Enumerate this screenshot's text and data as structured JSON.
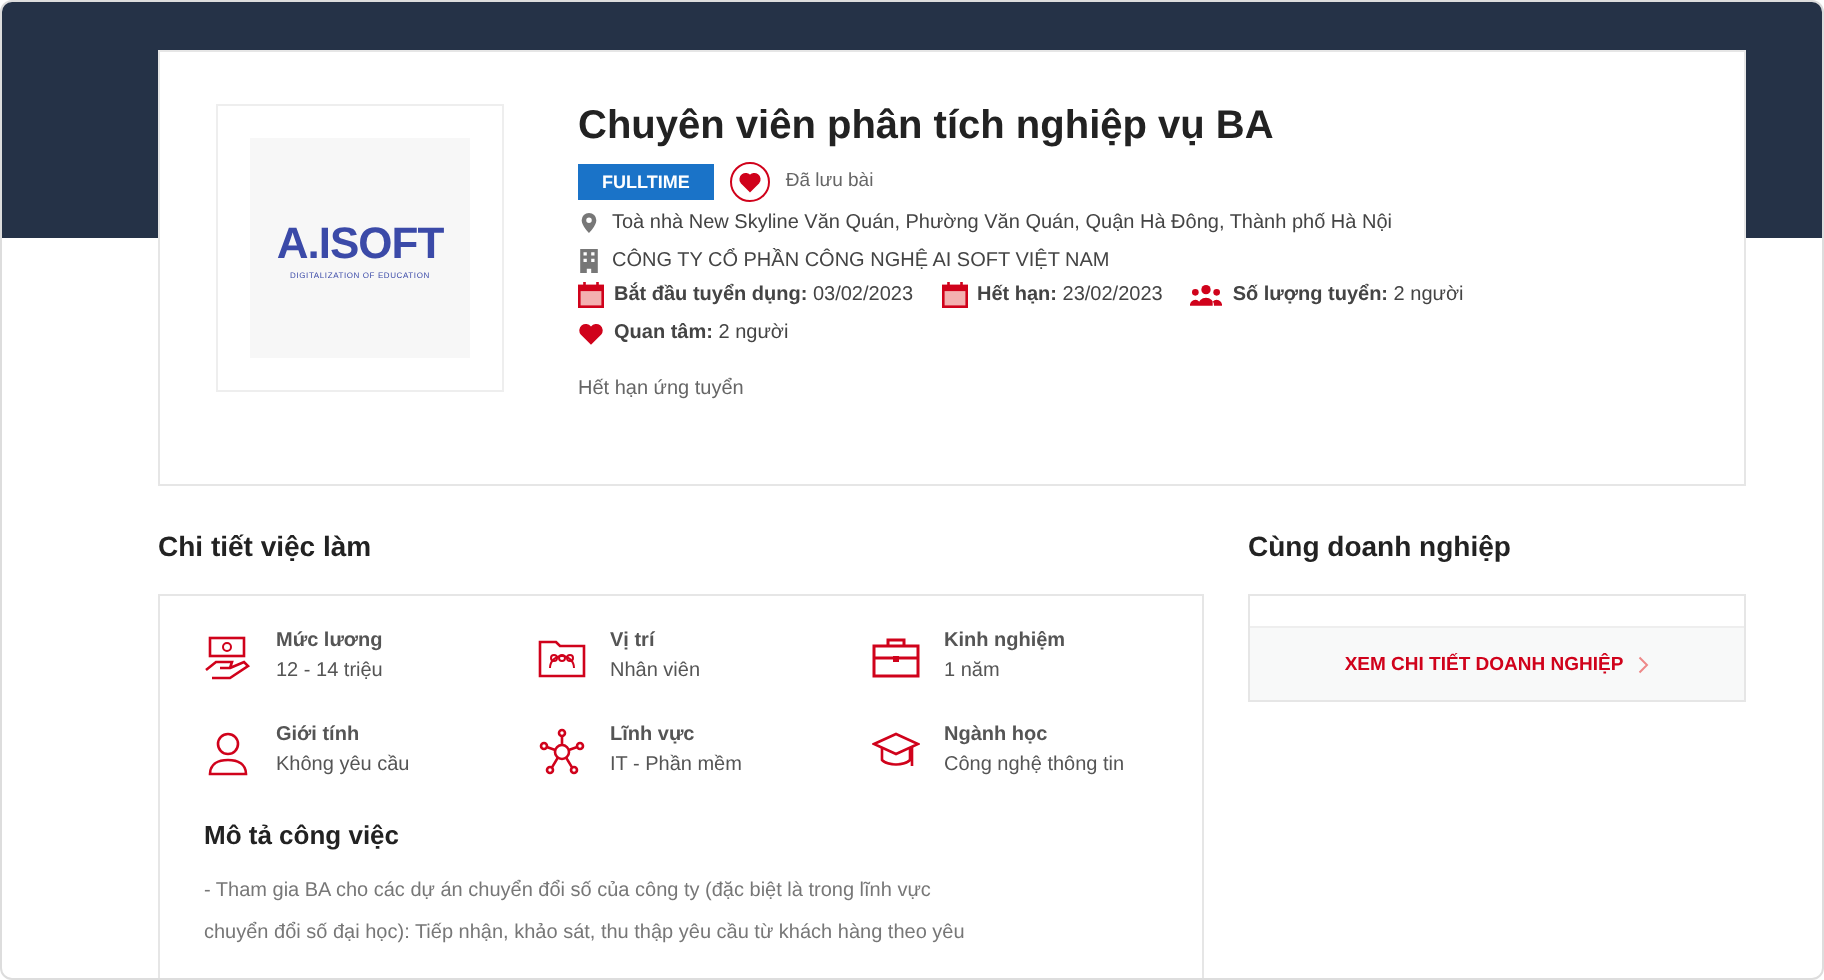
{
  "job": {
    "title": "Chuyên viên phân tích nghiệp vụ BA",
    "type_badge": "FULLTIME",
    "saved": true,
    "saved_label": "Đã lưu bài",
    "logo": {
      "name": "A.ISOFT",
      "tagline": "DIGITALIZATION OF EDUCATION"
    },
    "address": "Toà nhà New Skyline Văn Quán, Phường Văn Quán, Quận Hà Đông, Thành phố Hà Nội",
    "company": "CÔNG TY CỔ PHẦN CÔNG NGHỆ AI SOFT VIỆT NAM",
    "facts": [
      {
        "kind": "calendar",
        "label": "Bắt đầu tuyển dụng:",
        "value": "03/02/2023"
      },
      {
        "kind": "calendar",
        "label": "Hết hạn:",
        "value": "23/02/2023"
      },
      {
        "kind": "people",
        "label": "Số lượng tuyển:",
        "value": "2 người"
      },
      {
        "kind": "heart",
        "label": "Quan tâm:",
        "value": "2 người"
      }
    ],
    "status": "Hết hạn ứng tuyển"
  },
  "details": {
    "heading": "Chi tiết việc làm",
    "items": [
      {
        "kind": "salary",
        "label": "Mức lương",
        "value": "12 - 14 triệu"
      },
      {
        "kind": "position",
        "label": "Vị trí",
        "value": "Nhân viên"
      },
      {
        "kind": "experience",
        "label": "Kinh nghiệm",
        "value": "1 năm"
      },
      {
        "kind": "gender",
        "label": "Giới tính",
        "value": "Không yêu cầu"
      },
      {
        "kind": "field",
        "label": "Lĩnh vực",
        "value": "IT - Phần mềm"
      },
      {
        "kind": "major",
        "label": "Ngành học",
        "value": "Công nghệ thông tin"
      }
    ],
    "description_heading": "Mô tả công việc",
    "description_lines": [
      "- Tham gia BA cho các dự án chuyển đổi số của công ty (đặc biệt là trong lĩnh vực",
      "chuyển đổi số đại học): Tiếp nhận, khảo sát, thu thập yêu cầu từ khách hàng theo yêu"
    ]
  },
  "sidebar": {
    "heading": "Cùng doanh nghiệp",
    "link": "XEM CHI TIẾT DOANH NGHIỆP"
  }
}
